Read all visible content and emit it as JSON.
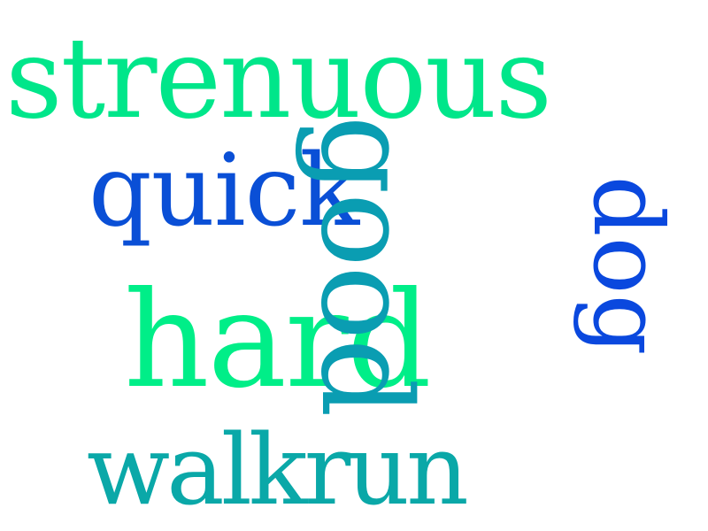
{
  "words": [
    {
      "key": "strenuous",
      "text": "strenuous",
      "color": "#00e68a"
    },
    {
      "key": "quick",
      "text": "quick",
      "color": "#0a4fd6"
    },
    {
      "key": "hard",
      "text": "hard",
      "color": "#00ee88"
    },
    {
      "key": "walkrun",
      "text": "walkrun",
      "color": "#0aa8a8"
    },
    {
      "key": "good",
      "text": "good",
      "color": "#0a9db2"
    },
    {
      "key": "dog",
      "text": "dog",
      "color": "#0a48de"
    }
  ]
}
